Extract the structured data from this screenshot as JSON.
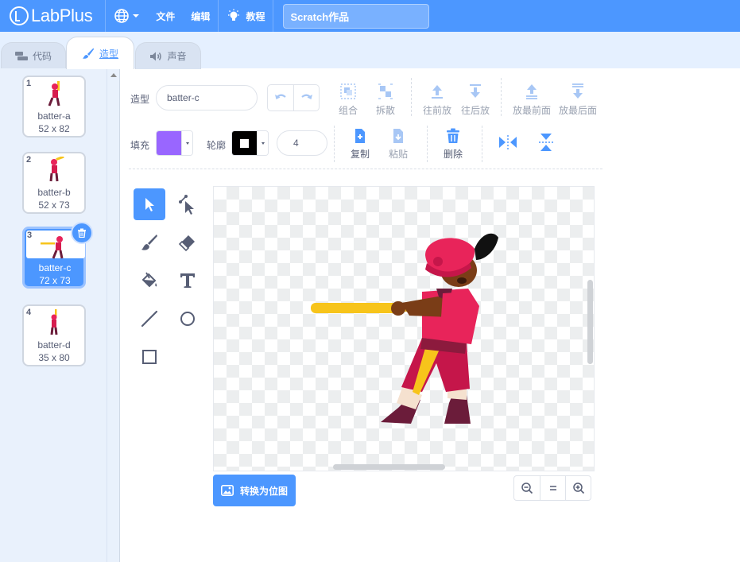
{
  "menubar": {
    "logo_text": "LabPlus",
    "language_icon": "globe-icon",
    "file_label": "文件",
    "edit_label": "编辑",
    "tutorial_label": "教程",
    "project_title": "Scratch作品"
  },
  "tabs": [
    {
      "label": "代码",
      "icon": "code-blocks-icon"
    },
    {
      "label": "造型",
      "icon": "brush-icon"
    },
    {
      "label": "声音",
      "icon": "speaker-icon"
    }
  ],
  "costumes": [
    {
      "number": "1",
      "name": "batter-a",
      "size": "52 x 82"
    },
    {
      "number": "2",
      "name": "batter-b",
      "size": "52 x 73"
    },
    {
      "number": "3",
      "name": "batter-c",
      "size": "72 x 73"
    },
    {
      "number": "4",
      "name": "batter-d",
      "size": "35 x 80"
    }
  ],
  "selected_costume": 3,
  "toolbar": {
    "costume_label": "造型",
    "costume_name": "batter-c",
    "group_label": "组合",
    "ungroup_label": "拆散",
    "forward_label": "往前放",
    "backward_label": "往后放",
    "front_label": "放最前面",
    "back_label": "放最后面",
    "fill_label": "填充",
    "outline_label": "轮廓",
    "outline_width": "4",
    "copy_label": "复制",
    "paste_label": "粘贴",
    "delete_label": "删除"
  },
  "colors": {
    "accent": "#4c97ff",
    "fill_color": "#9966ff",
    "outline_color": "#000000"
  },
  "canvas": {
    "convert_label": "转换为位图"
  }
}
